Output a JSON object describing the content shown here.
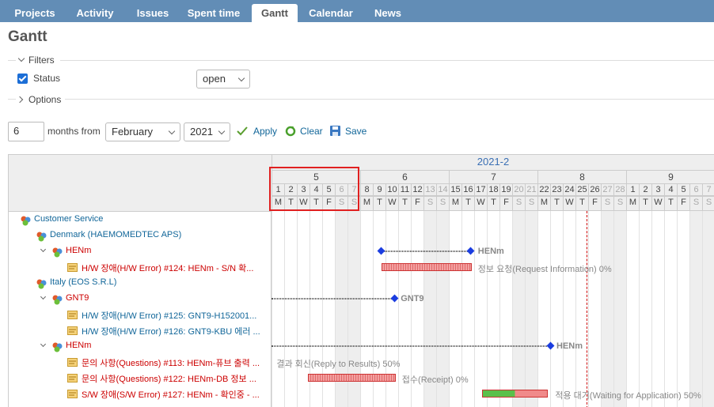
{
  "tabs": [
    "Projects",
    "Activity",
    "Issues",
    "Spent time",
    "Gantt",
    "Calendar",
    "News"
  ],
  "page_title": "Gantt",
  "filters_label": "Filters",
  "status_label": "Status",
  "status_value": "open",
  "options_label": "Options",
  "months_value": "6",
  "months_from_label": "months from",
  "month_value": "February",
  "year_value": "2021",
  "apply_label": "Apply",
  "clear_label": "Clear",
  "save_label": "Save",
  "period_label": "2021-2",
  "weeks": [
    "5",
    "6",
    "7",
    "8",
    "9"
  ],
  "day_numbers": [
    "1",
    "2",
    "3",
    "4",
    "5",
    "6",
    "7",
    "8",
    "9",
    "10",
    "11",
    "12",
    "13",
    "14",
    "15",
    "16",
    "17",
    "18",
    "19",
    "20",
    "21",
    "22",
    "23",
    "24",
    "25",
    "26",
    "27",
    "28",
    "1",
    "2",
    "3",
    "4",
    "5",
    "6",
    "7"
  ],
  "day_letters": [
    "M",
    "T",
    "W",
    "T",
    "F",
    "S",
    "S",
    "M",
    "T",
    "W",
    "T",
    "F",
    "S",
    "S",
    "M",
    "T",
    "W",
    "T",
    "F",
    "S",
    "S",
    "M",
    "T",
    "W",
    "T",
    "F",
    "S",
    "S",
    "M",
    "T",
    "W",
    "T",
    "F",
    "S",
    "S"
  ],
  "rows": [
    {
      "label": "Customer Service",
      "kind": "proj"
    },
    {
      "label": "Denmark (HAEMOMEDTEC APS)",
      "kind": "proj"
    },
    {
      "label": "HENm",
      "kind": "ver"
    },
    {
      "label": "H/W 장애(H/W Error) #124: HENm - S/N 확...",
      "kind": "issue-red"
    },
    {
      "label": "Italy (EOS S.R.L)",
      "kind": "proj"
    },
    {
      "label": "GNT9",
      "kind": "ver"
    },
    {
      "label": "H/W 장애(H/W Error) #125: GNT9-H152001...",
      "kind": "issue"
    },
    {
      "label": "H/W 장애(H/W Error) #126: GNT9-KBU 에러 ...",
      "kind": "issue"
    },
    {
      "label": "HENm",
      "kind": "ver"
    },
    {
      "label": "문의 사항(Questions) #113: HENm-퓨브 출력 ...",
      "kind": "issue-red"
    },
    {
      "label": "문의 사항(Questions) #122: HENm-DB 정보 ...",
      "kind": "issue-red"
    },
    {
      "label": "S/W 장애(S/W Error) #127: HENm - 확인중 - ...",
      "kind": "issue-red"
    }
  ],
  "bar_labels": {
    "henm1": "HENm",
    "r124": "정보 요청(Request Information) 0%",
    "gnt9": "GNT9",
    "henm2": "HENm",
    "r113": "결과 회신(Reply to Results) 50%",
    "r122": "접수(Receipt) 0%",
    "r127": "적용 대기(Waiting for Application) 50%"
  }
}
